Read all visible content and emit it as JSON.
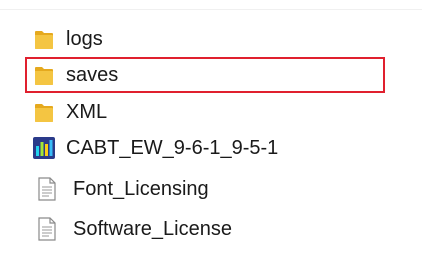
{
  "explorer": {
    "items": [
      {
        "name": "logs",
        "type": "folder",
        "icon": "folder-icon",
        "selected": false
      },
      {
        "name": "saves",
        "type": "folder",
        "icon": "folder-icon",
        "selected": true
      },
      {
        "name": "XML",
        "type": "folder",
        "icon": "folder-icon",
        "selected": false
      },
      {
        "name": "CABT_EW_9-6-1_9-5-1",
        "type": "application",
        "icon": "app-chart-icon",
        "selected": false
      },
      {
        "name": "Font_Licensing",
        "type": "document",
        "icon": "document-icon",
        "selected": false
      },
      {
        "name": "Software_License",
        "type": "document",
        "icon": "document-icon",
        "selected": false
      }
    ],
    "colors": {
      "folder": "#f4c542",
      "folder_dark": "#e5a91e",
      "selection_outline": "#e0202e",
      "app_icon_bg": "#2a3a8a",
      "app_bars": [
        "#22d3ee",
        "#a3e635",
        "#facc15",
        "#38bdf8"
      ]
    }
  }
}
